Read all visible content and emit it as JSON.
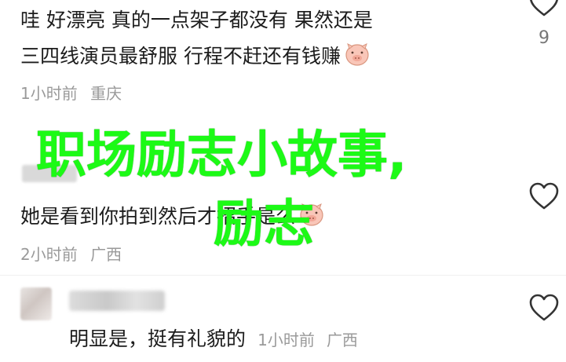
{
  "comments": [
    {
      "lines": [
        "哇 好漂亮 真的一点架子都没有 果然还是",
        "三四线演员最舒服 行程不赶还有钱赚"
      ],
      "time": "1小时前",
      "location": "重庆",
      "likes": "9",
      "reaction_icon": "pig-face-emoji"
    },
    {
      "lines": [
        "她是看到你拍到然后才招手是么"
      ],
      "time": "2小时前",
      "location": "广西",
      "reaction_icon": "pig-face-emoji"
    },
    {
      "reply_text": "明显是，挺有礼貌的",
      "time": "1小时前",
      "location": "广西"
    }
  ],
  "overlay": {
    "line1": "职场励志小故事,",
    "line2": "励志"
  },
  "colors": {
    "overlay_green": "#1cfa16",
    "meta_gray": "#9a9a9a"
  }
}
